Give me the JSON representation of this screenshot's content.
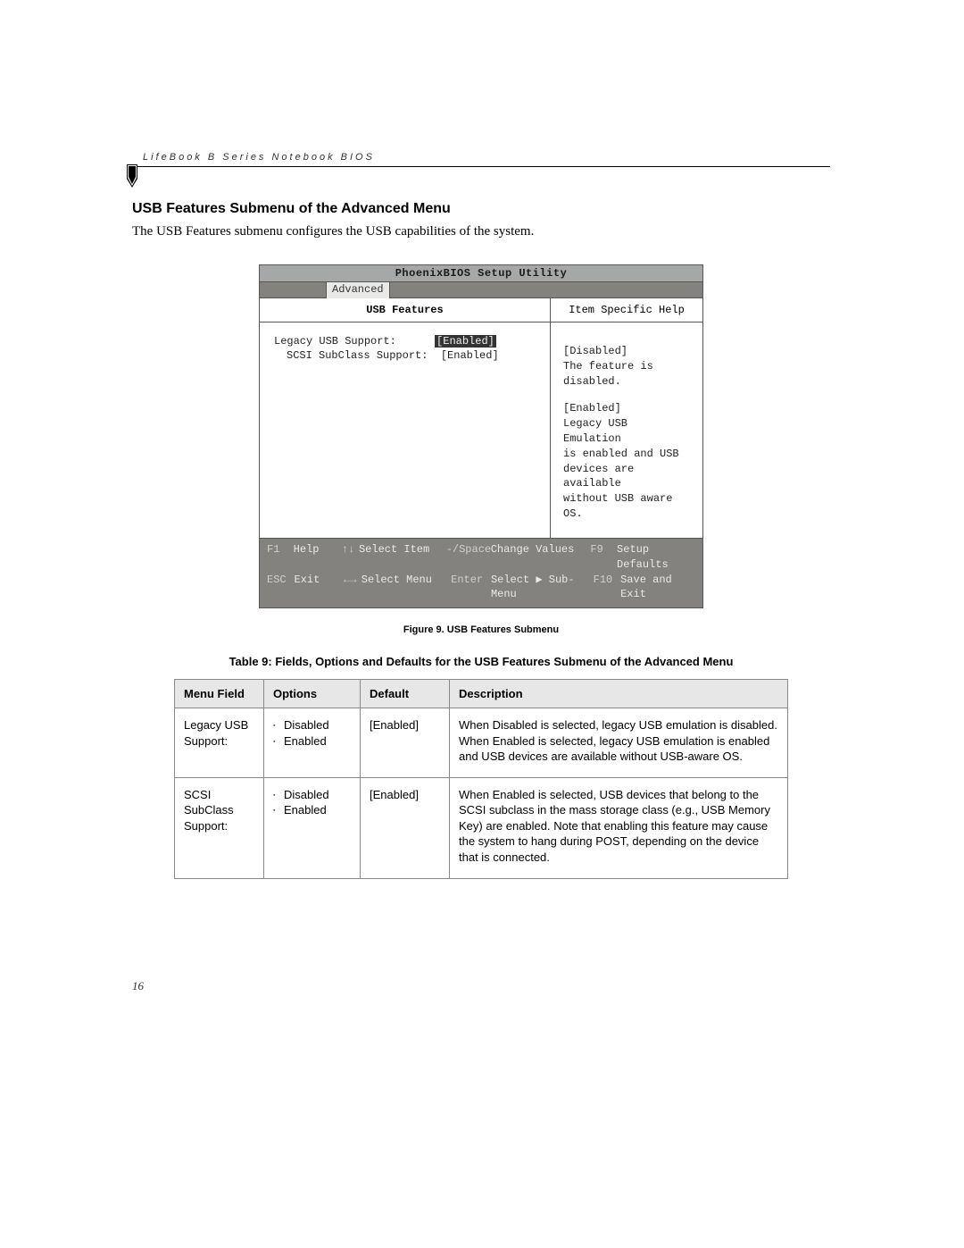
{
  "runningHead": "LifeBook B Series Notebook BIOS",
  "sectionTitle": "USB Features Submenu of the Advanced Menu",
  "intro": "The USB Features submenu configures the USB capabilities of the system.",
  "bios": {
    "title": "PhoenixBIOS Setup Utility",
    "tab": "Advanced",
    "panelTitle": "USB Features",
    "helpTitle": "Item Specific Help",
    "opt1Label": "Legacy USB Support:",
    "opt1Value": "[Enabled]",
    "opt2Label": "SCSI SubClass Support:",
    "opt2Value": "[Enabled]",
    "help1a": "[Disabled]",
    "help1b": "The feature is disabled.",
    "help2a": "[Enabled]",
    "help2b": "Legacy USB Emulation",
    "help2c": "is enabled and USB",
    "help2d": "devices are available",
    "help2e": "without USB aware OS.",
    "foot": {
      "f1": "F1",
      "help": "Help",
      "arrUD": "↑↓",
      "selItem": "Select Item",
      "minus": "-/Space",
      "chg": "Change Values",
      "f9": "F9",
      "setup": "Setup Defaults",
      "esc": "ESC",
      "exit": "Exit",
      "arrLR": "←→",
      "selMenu": "Select Menu",
      "enter": "Enter",
      "sub": "Select ▶ Sub-Menu",
      "f10": "F10",
      "save": "Save and Exit"
    }
  },
  "figureCaption": "Figure 9.  USB Features Submenu",
  "tableTitle": "Table 9: Fields, Options and Defaults for the USB Features Submenu of the Advanced Menu",
  "th": {
    "menu": "Menu Field",
    "opts": "Options",
    "def": "Default",
    "desc": "Description"
  },
  "rows": [
    {
      "menu": "Legacy USB Support:",
      "opts": [
        "Disabled",
        "Enabled"
      ],
      "def": "[Enabled]",
      "desc": "When Disabled is selected, legacy USB emulation is disabled. When Enabled is selected, legacy USB emulation is enabled and USB devices are available without USB-aware OS."
    },
    {
      "menu": "SCSI SubClass Support:",
      "opts": [
        "Disabled",
        "Enabled"
      ],
      "def": "[Enabled]",
      "desc": "When Enabled is selected, USB devices that belong to the SCSI subclass in the mass storage class (e.g., USB Memory Key) are enabled. Note that enabling this feature may cause the system to hang during POST, depending on the device that is connected."
    }
  ],
  "pageNum": "16"
}
